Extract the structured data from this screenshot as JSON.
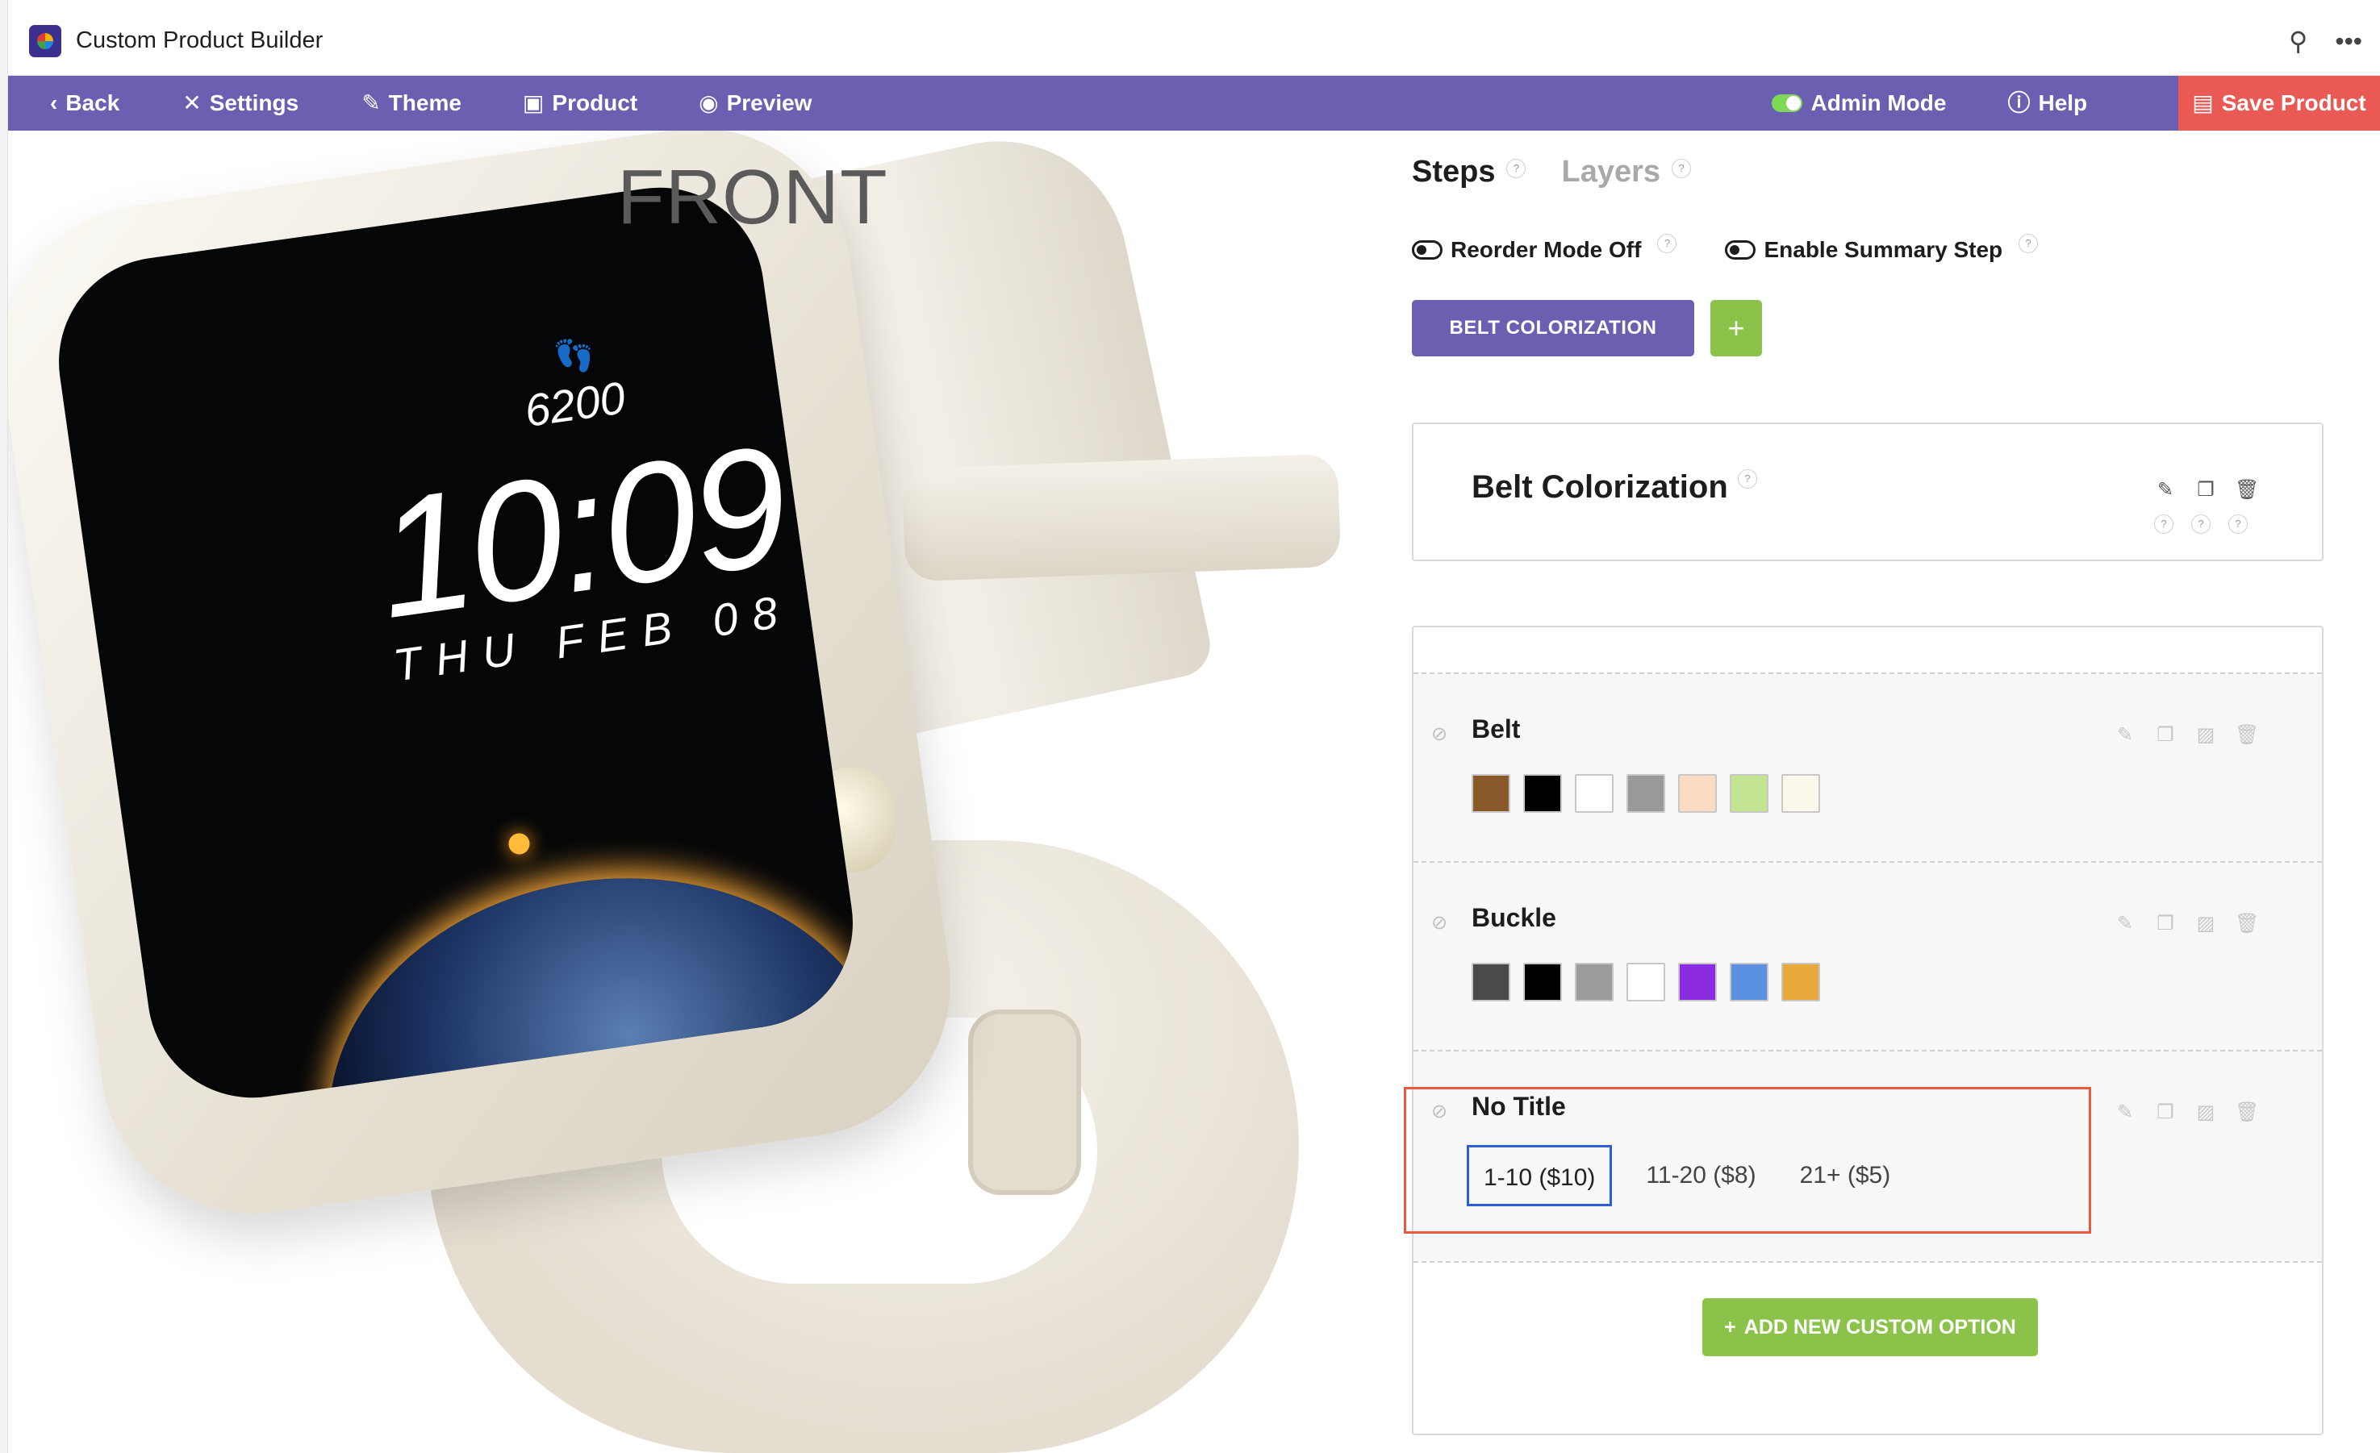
{
  "window": {
    "title": "Custom Product Builder",
    "pin_icon": "pin-icon",
    "more_icon": "more-icon"
  },
  "toolbar": {
    "back": "Back",
    "settings": "Settings",
    "theme": "Theme",
    "product": "Product",
    "preview": "Preview",
    "admin_mode": "Admin Mode",
    "help": "Help",
    "save": "Save Product",
    "accent": "#6a5fb0",
    "save_color": "#ea5a55"
  },
  "canvas": {
    "view_label": "FRONT",
    "watch_face": {
      "steps": "6200",
      "time": "10:09",
      "date": "THU FEB 08"
    }
  },
  "panel": {
    "tabs": [
      {
        "label": "Steps",
        "active": true
      },
      {
        "label": "Layers",
        "active": false
      }
    ],
    "reorder_mode": "Reorder Mode Off",
    "summary_step": "Enable Summary Step",
    "step_tab": "BELT COLORIZATION",
    "add_step": "+",
    "step_card_title": "Belt Colorization",
    "options": [
      {
        "title": "Belt",
        "swatches": [
          "#8a5a2b",
          "#000000",
          "#ffffff",
          "#999999",
          "#fbdcc0",
          "#c3e591",
          "#fbf7ea"
        ]
      },
      {
        "title": "Buckle",
        "swatches": [
          "#4a4a4a",
          "#000000",
          "#9c9c9c",
          "#ffffff",
          "#8a2be2",
          "#5b8fe0",
          "#e9a83a"
        ]
      },
      {
        "title": "No Title",
        "choices": [
          "1-10 ($10)",
          "11-20 ($8)",
          "21+ ($5)"
        ],
        "selected_choice": "1-10 ($10)"
      }
    ],
    "add_option": "ADD NEW CUSTOM OPTION",
    "add_color": "#8bc34a",
    "highlight_color": "#ea5a3d"
  }
}
